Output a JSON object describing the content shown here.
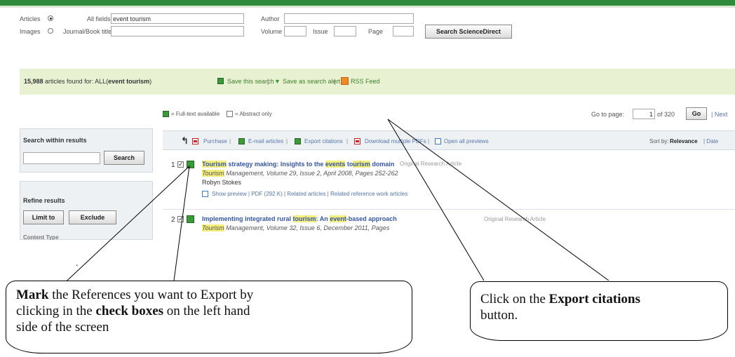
{
  "search_form": {
    "articles_label": "Articles",
    "images_label": "Images",
    "all_fields_label": "All fields",
    "all_fields_value": "event tourism",
    "journal_label": "Journal/Book title",
    "author_label": "Author",
    "volume_label": "Volume",
    "issue_label": "Issue",
    "page_label": "Page",
    "search_button": "Search ScienceDirect"
  },
  "results_banner": {
    "count": "15,988",
    "text": "articles found for: ALL(",
    "query": "event tourism",
    "close": ")",
    "save_search": "Save this search",
    "save_alert": "Save as search alert",
    "rss": "RSS Feed"
  },
  "legend": {
    "full_text": "= Full-text available",
    "abstract": "= Abstract only"
  },
  "pagination": {
    "goto_label": "Go to page:",
    "current": "1",
    "of": "of 320",
    "go_button": "Go",
    "next": "| Next"
  },
  "sidebar": {
    "search_within_title": "Search within results",
    "search_button": "Search",
    "refine_title": "Refine results",
    "limit_button": "Limit to",
    "exclude_button": "Exclude",
    "partial_heading": "Content Type"
  },
  "toolbar": {
    "purchase": "Purchase",
    "email": "E-mail articles",
    "export": "Export citations",
    "download": "Download multiple PDFs",
    "previews": "Open all previews",
    "sort_label": "Sort by:",
    "sort_value": "Relevance",
    "sort_alt": "| Date"
  },
  "results": [
    {
      "num": "1",
      "title_pre": "Tourism",
      "title_mid": " strategy making: Insights to the ",
      "title_hl1": "events",
      "title_gap": " to",
      "title_hl2": "urism",
      "title_post": " domain",
      "type": "Original Research Article",
      "journal": "Tourism",
      "meta": " Management, Volume 29, Issue 2, April 2008, Pages 252-262",
      "author": "Robyn Stokes",
      "links": "Show preview  |  PDF (292 K)  |  Related articles  |  Related reference work articles"
    },
    {
      "num": "2",
      "title_pre": "Implementing integrated rural ",
      "title_hl": "tourism",
      "title_mid": ": An ",
      "title_hl2": "event",
      "title_post": "-based approach",
      "type": "Original Research Article",
      "journal": "Tourism",
      "meta": " Management, Volume 32, Issue 6, December 2011, Pages"
    }
  ],
  "callouts": {
    "left_bold1": "Mark",
    "left_text1": " the References you want to Export by",
    "left_text2": "clicking in the ",
    "left_bold2": "check boxes",
    "left_text3": " on the left hand",
    "left_text4": "side of the screen",
    "right_text1": "Click on the ",
    "right_bold": "Export citations",
    "right_text2": "button.",
    "dot": "."
  }
}
